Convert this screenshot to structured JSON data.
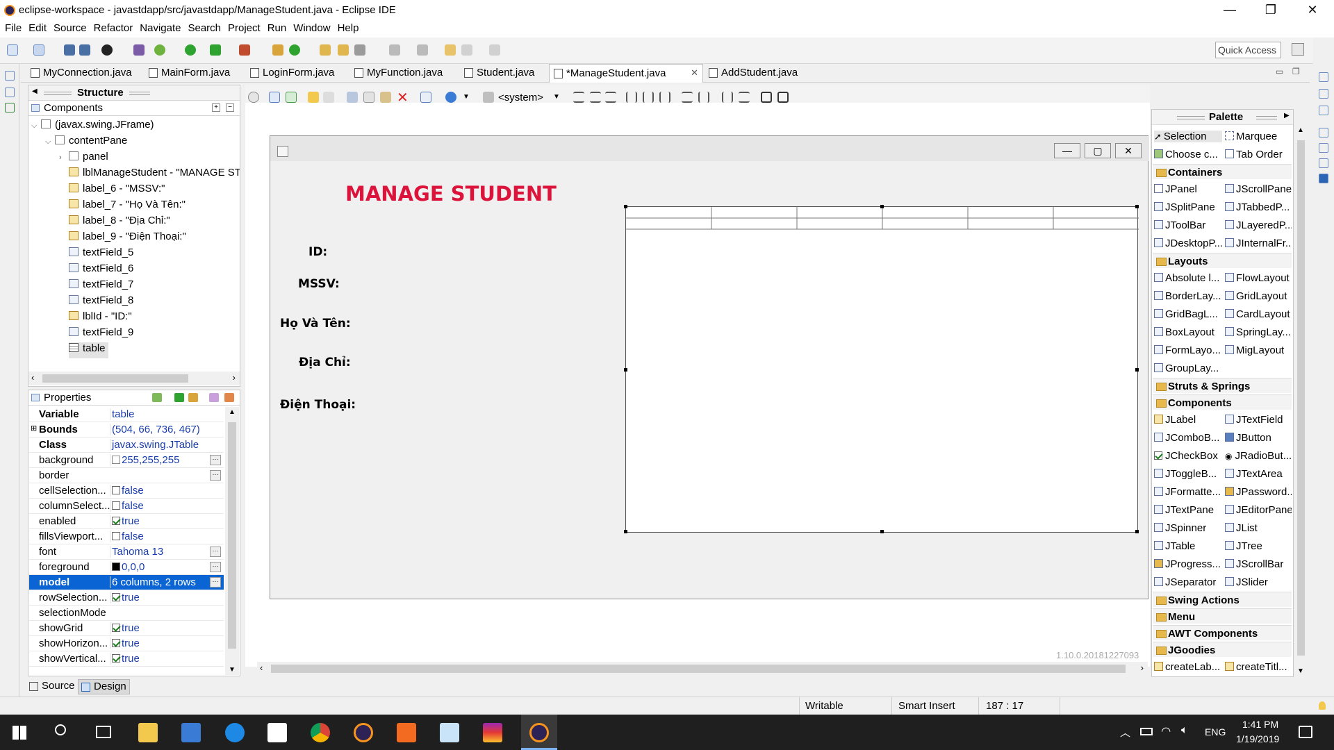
{
  "window": {
    "title": "eclipse-workspace - javastdapp/src/javastdapp/ManageStudent.java - Eclipse IDE"
  },
  "menu": [
    "File",
    "Edit",
    "Source",
    "Refactor",
    "Navigate",
    "Search",
    "Project",
    "Run",
    "Window",
    "Help"
  ],
  "quick_access": "Quick Access",
  "tabs": [
    "MyConnection.java",
    "MainForm.java",
    "LoginForm.java",
    "MyFunction.java",
    "Student.java",
    "*ManageStudent.java",
    "AddStudent.java"
  ],
  "structure": {
    "title": "Structure",
    "components_title": "Components",
    "tree": [
      "(javax.swing.JFrame)",
      "contentPane",
      "panel",
      "lblManageStudent - \"MANAGE ST",
      "label_6 - \"MSSV:\"",
      "label_7 - \"Họ Và Tên:\"",
      "label_8 - \"Địa Chỉ:\"",
      "label_9 - \"Điện Thoại:\"",
      "textField_5",
      "textField_6",
      "textField_7",
      "textField_8",
      "lblId - \"ID:\"",
      "textField_9",
      "table"
    ]
  },
  "properties": {
    "title": "Properties",
    "rows": [
      {
        "name": "Variable",
        "value": "table"
      },
      {
        "name": "Bounds",
        "value": "(504, 66, 736, 467)"
      },
      {
        "name": "Class",
        "value": "javax.swing.JTable"
      },
      {
        "name": "background",
        "value": "255,255,255"
      },
      {
        "name": "border",
        "value": ""
      },
      {
        "name": "cellSelection...",
        "value": "false"
      },
      {
        "name": "columnSelect...",
        "value": "false"
      },
      {
        "name": "enabled",
        "value": "true"
      },
      {
        "name": "fillsViewport...",
        "value": "false"
      },
      {
        "name": "font",
        "value": "Tahoma 13"
      },
      {
        "name": "foreground",
        "value": "0,0,0"
      },
      {
        "name": "model",
        "value": "6 columns, 2 rows"
      },
      {
        "name": "rowSelection...",
        "value": "true"
      },
      {
        "name": "selectionMode",
        "value": ""
      },
      {
        "name": "showGrid",
        "value": "true"
      },
      {
        "name": "showHorizon...",
        "value": "true"
      },
      {
        "name": "showVertical...",
        "value": "true"
      }
    ]
  },
  "design_toolbar": {
    "system": "<system>"
  },
  "form": {
    "heading": "MANAGE STUDENT",
    "labels": [
      "ID:",
      "MSSV:",
      "Họ Và Tên:",
      "Địa Chỉ:",
      "Điện Thoại:"
    ],
    "version": "1.10.0.20181227093"
  },
  "palette": {
    "title": "Palette",
    "tools": [
      "Selection",
      "Marquee",
      "Choose c...",
      "Tab Order"
    ],
    "containers_title": "Containers",
    "containers": [
      "JPanel",
      "JScrollPane",
      "JSplitPane",
      "JTabbedP...",
      "JToolBar",
      "JLayeredP...",
      "JDesktopP...",
      "JInternalFr..."
    ],
    "layouts_title": "Layouts",
    "layouts": [
      "Absolute l...",
      "FlowLayout",
      "BorderLay...",
      "GridLayout",
      "GridBagL...",
      "CardLayout",
      "BoxLayout",
      "SpringLay...",
      "FormLayo...",
      "MigLayout",
      "GroupLay..."
    ],
    "struts_title": "Struts & Springs",
    "components_title": "Components",
    "components": [
      "JLabel",
      "JTextField",
      "JComboB...",
      "JButton",
      "JCheckBox",
      "JRadioBut...",
      "JToggleB...",
      "JTextArea",
      "JFormatte...",
      "JPassword...",
      "JTextPane",
      "JEditorPane",
      "JSpinner",
      "JList",
      "JTable",
      "JTree",
      "JProgress...",
      "JScrollBar",
      "JSeparator",
      "JSlider"
    ],
    "swing_actions_title": "Swing Actions",
    "menu_title": "Menu",
    "awt_title": "AWT Components",
    "jgoodies_title": "JGoodies",
    "jgoodies": [
      "createLab...",
      "createTitl..."
    ]
  },
  "bottom_tabs": [
    "Source",
    "Design"
  ],
  "status": {
    "writable": "Writable",
    "insert": "Smart Insert",
    "position": "187 : 17"
  },
  "taskbar": {
    "lang": "ENG",
    "time": "1:41 PM",
    "date": "1/19/2019"
  }
}
